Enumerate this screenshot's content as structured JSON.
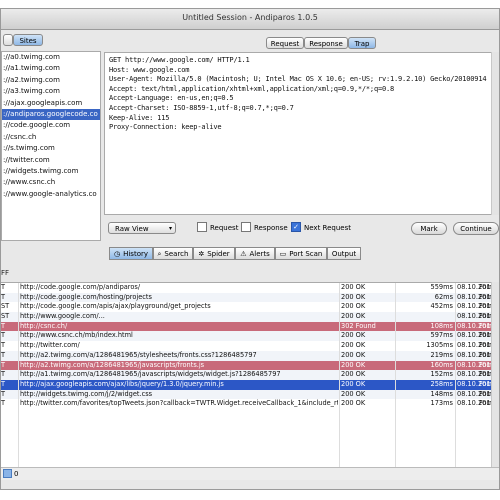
{
  "window": {
    "title": "Untitled Session - Andiparos 1.0.5"
  },
  "sites_button": "Sites",
  "sites": [
    "://a0.twimg.com",
    "://a1.twimg.com",
    "://a2.twimg.com",
    "://a3.twimg.com",
    "://ajax.googleapis.com",
    "://andiparos.googlecode.co",
    "://code.google.com",
    "://csnc.ch",
    "://s.twimg.com",
    "://twitter.com",
    "://widgets.twimg.com",
    "://www.csnc.ch",
    "://www.google-analytics.co"
  ],
  "selected_site_index": 5,
  "request_tabs": [
    "Request",
    "Response",
    "Trap"
  ],
  "selected_request_tab": "Trap",
  "raw_request": [
    "GET http://www.google.com/ HTTP/1.1",
    "Host: www.google.com",
    "User-Agent: Mozilla/5.0 (Macintosh; U; Intel Mac OS X 10.6; en-US; rv:1.9.2.10) Gecko/20100914 Firefox/3.6.10",
    "Accept: text/html,application/xhtml+xml,application/xml;q=0.9,*/*;q=0.8",
    "Accept-Language: en-us,en;q=0.5",
    "Accept-Charset: ISO-8859-1,utf-8;q=0.7,*;q=0.7",
    "Keep-Alive: 115",
    "Proxy-Connection: keep-alive"
  ],
  "controls": {
    "view_select": "Raw View",
    "cb_request": "Request",
    "cb_response": "Response",
    "cb_next_request": "Next Request",
    "mark_button": "Mark",
    "continue_button": "Continue",
    "cb_next_request_checked": true
  },
  "bottom_tabs": [
    {
      "label": "History",
      "icon": "clock-icon"
    },
    {
      "label": "Search",
      "icon": "magnifier-icon"
    },
    {
      "label": "Spider",
      "icon": "spider-icon"
    },
    {
      "label": "Alerts",
      "icon": "warning-icon"
    },
    {
      "label": "Port Scan",
      "icon": "scan-icon"
    },
    {
      "label": "Output",
      "icon": "output-icon"
    }
  ],
  "filter_label": "FF",
  "history": [
    {
      "method": "T",
      "url": "http://code.google.com/p/andiparos/",
      "status": "200 OK",
      "time": "559ms",
      "date": "08.10.201...",
      "note": "Form,",
      "style": "normal"
    },
    {
      "method": "T",
      "url": "http://code.google.com/hosting/projects",
      "status": "200 OK",
      "time": "62ms",
      "date": "08.10.201...",
      "note": "Form,",
      "style": "normal"
    },
    {
      "method": "ST",
      "url": "http://code.google.com/apis/ajax/playground/get_projects",
      "status": "200 OK",
      "time": "452ms",
      "date": "08.10.201...",
      "note": "Form,",
      "style": "normal"
    },
    {
      "method": "ST",
      "url": "http://www.google.com/...",
      "status": "200 OK",
      "time": "",
      "date": "08.10.201...",
      "note": "Form,",
      "style": "normal"
    },
    {
      "method": "T",
      "url": "http://csnc.ch/",
      "status": "302 Found",
      "time": "108ms",
      "date": "08.10.201...",
      "note": "Form,",
      "style": "err"
    },
    {
      "method": "T",
      "url": "http://www.csnc.ch/mb/index.html",
      "status": "200 OK",
      "time": "597ms",
      "date": "08.10.201...",
      "note": "Form,",
      "style": "normal"
    },
    {
      "method": "T",
      "url": "http://twitter.com/",
      "status": "200 OK",
      "time": "1305ms",
      "date": "08.10.201...",
      "note": "Form,",
      "style": "normal"
    },
    {
      "method": "T",
      "url": "http://a2.twimg.com/a/1286481965/stylesheets/fronts.css?1286485797",
      "status": "200 OK",
      "time": "219ms",
      "date": "08.10.201...",
      "note": "Form,",
      "style": "normal"
    },
    {
      "method": "T",
      "url": "http://a2.twimg.com/a/1286481965/javascripts/fronts.js",
      "status": "200 OK",
      "time": "160ms",
      "date": "08.10.201...",
      "note": "Form,",
      "style": "err"
    },
    {
      "method": "T",
      "url": "http://a1.twimg.com/a/1286481965/javascripts/widgets/widget.js?1286485797",
      "status": "200 OK",
      "time": "152ms",
      "date": "08.10.201...",
      "note": "Form,",
      "style": "normal"
    },
    {
      "method": "T",
      "url": "http://ajax.googleapis.com/ajax/libs/jquery/1.3.0/jquery.min.js",
      "status": "200 OK",
      "time": "258ms",
      "date": "08.10.201...",
      "note": "Form,",
      "style": "sel"
    },
    {
      "method": "T",
      "url": "http://widgets.twimg.com/j/2/widget.css",
      "status": "200 OK",
      "time": "148ms",
      "date": "08.10.201...",
      "note": "Form,",
      "style": "normal"
    },
    {
      "method": "T",
      "url": "http://twitter.com/favorites/topTweets.json?callback=TWTR.Widget.receiveCallback_1&include_rts...",
      "status": "200 OK",
      "time": "173ms",
      "date": "08.10.201...",
      "note": "Form,",
      "style": "normal"
    }
  ],
  "status_count": "0"
}
